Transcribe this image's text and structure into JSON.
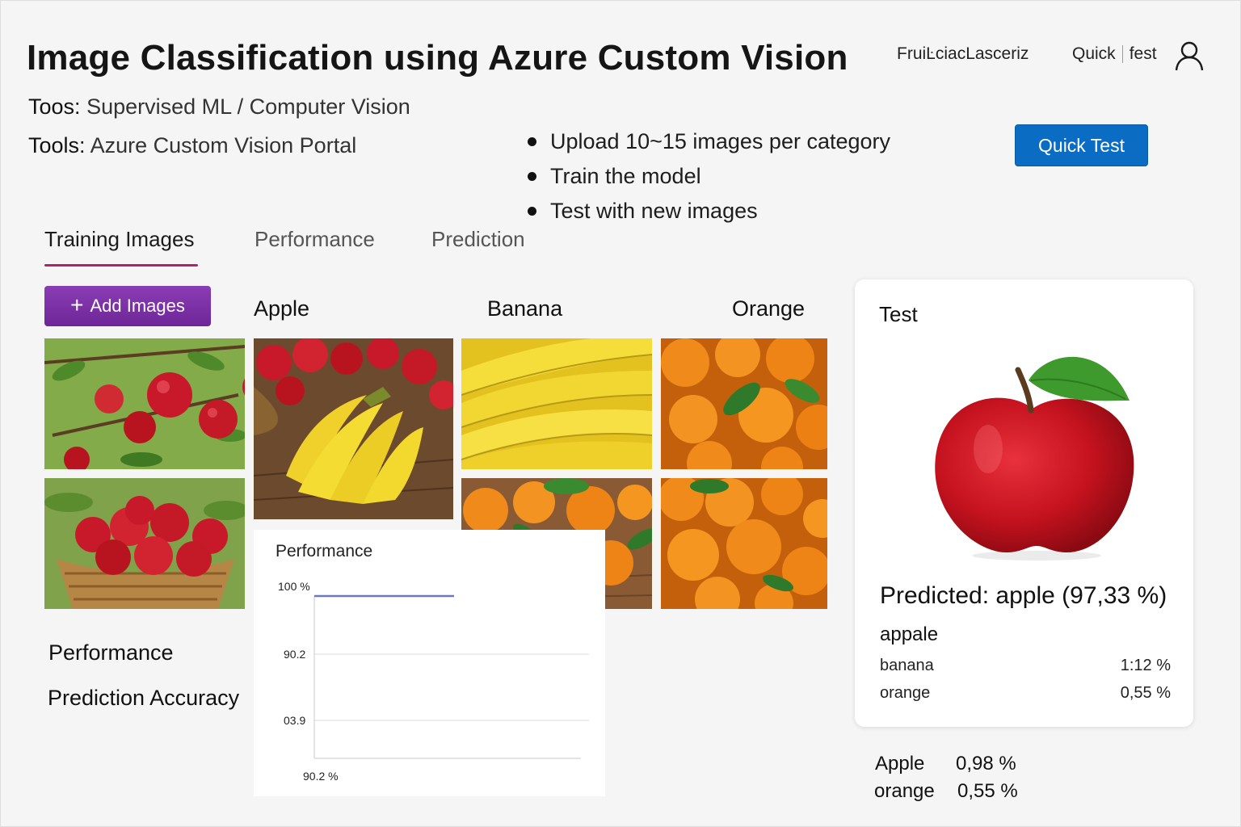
{
  "header": {
    "title": "Image Classification using Azure Custom Vision",
    "topic_key": "Toos:",
    "topic_value": "Supervised ML / Computer Vision",
    "tools_key": "Tools:",
    "tools_value": "Azure Custom Vision Portal",
    "nav_project": "FruiĿciacLasceriz",
    "nav_quick": "Quick",
    "nav_fest": "fest",
    "user_icon": "user-icon"
  },
  "steps": [
    "Upload 10~15 images per category",
    "Train the model",
    "Test with new images"
  ],
  "quick_test_label": "Quick Test",
  "tabs": [
    {
      "label": "Training Images",
      "active": true
    },
    {
      "label": "Performance",
      "active": false
    },
    {
      "label": "Prediction",
      "active": false
    }
  ],
  "add_images_label": "Add Images",
  "categories": [
    "Apple",
    "Banana",
    "Orange"
  ],
  "side_labels": {
    "performance": "Performance",
    "accuracy": "Prediction Accuracy"
  },
  "performance_card": {
    "title": "Performance",
    "y_ticks": [
      "100 %",
      "90.2",
      "03.9"
    ],
    "x_label": "90.2 %"
  },
  "test_panel": {
    "title": "Test",
    "predicted": "Predicted: apple (97,33 %)",
    "top_tag": "appale",
    "rows": [
      {
        "label": "banana",
        "pct": "1:12 %"
      },
      {
        "label": "orange",
        "pct": "0,55 %"
      }
    ]
  },
  "bottom_results": [
    {
      "label": "Apple",
      "pct": "0,98 %"
    },
    {
      "label": "orange",
      "pct": "0,55 %"
    }
  ],
  "colors": {
    "primary_button": "#0b6cc4",
    "add_button": "#7a2fa6",
    "tab_underline": "#b0226a",
    "chart_line": "#6b78c8"
  },
  "chart_data": {
    "type": "line",
    "title": "Performance",
    "y_tick_labels": [
      "100 %",
      "90.2",
      "03.9"
    ],
    "x_tick_labels": [
      "90.2 %"
    ],
    "series": [
      {
        "values": [
          100,
          100
        ]
      }
    ],
    "grid": true
  }
}
